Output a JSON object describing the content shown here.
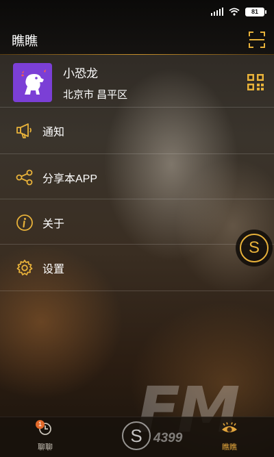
{
  "status_bar": {
    "battery": "81"
  },
  "header": {
    "title": "瞧瞧",
    "scan_icon": "scan-icon"
  },
  "profile": {
    "name": "小恐龙",
    "location": "北京市 昌平区",
    "qr_icon": "qr-code-icon"
  },
  "menu": [
    {
      "label": "通知",
      "icon": "megaphone-icon"
    },
    {
      "label": "分享本APP",
      "icon": "share-icon"
    },
    {
      "label": "关于",
      "icon": "info-icon"
    },
    {
      "label": "设置",
      "icon": "gear-icon"
    }
  ],
  "floating_button": {
    "label": "S"
  },
  "watermark": {
    "fm": "FM",
    "site": "4399",
    "center": "S"
  },
  "tabbar": {
    "chat": {
      "label": "聊聊",
      "badge": "1"
    },
    "look": {
      "label": "瞧瞧"
    }
  },
  "colors": {
    "accent": "#e8b23a",
    "avatar_bg": "#7b3fd6",
    "badge": "#e2692a"
  }
}
